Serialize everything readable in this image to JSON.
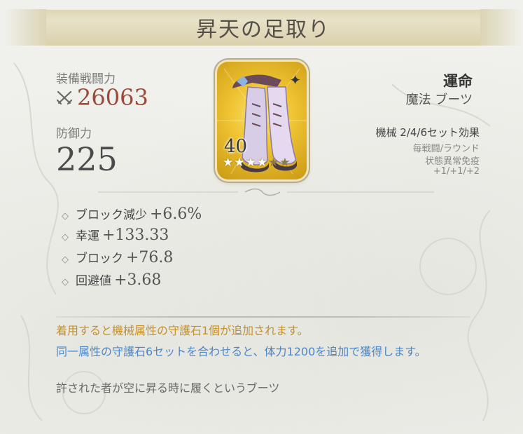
{
  "title": "昇天の足取り",
  "power": {
    "label": "装備戦闘力",
    "value": "26063"
  },
  "defense": {
    "label": "防御力",
    "value": "225"
  },
  "item": {
    "level": "40",
    "stars_total": 6,
    "stars_filled": 4,
    "accent_color": "#f0c433"
  },
  "name": {
    "main": "運命",
    "type": "魔法 ブーツ"
  },
  "set_effect": {
    "title": "機械 2/4/6セット効果",
    "lines": [
      "毎戦闘/ラウンド",
      "状態異常免疫",
      "+1/+1/+2"
    ]
  },
  "substats": [
    {
      "label": "ブロック減少",
      "value": "+6.6%"
    },
    {
      "label": "幸運",
      "value": "+133.33"
    },
    {
      "label": "ブロック",
      "value": "+76.8"
    },
    {
      "label": "回避値",
      "value": "+3.68"
    }
  ],
  "descriptions": {
    "gold": "着用すると機械属性の守護石1個が追加されます。",
    "blue": "同一属性の守護石6セットを合わせると、体力1200を追加で獲得します。",
    "gray": "許された者が空に昇る時に履くというブーツ"
  },
  "colors": {
    "power": "#9a4a3a",
    "gold_text": "#c4902a",
    "blue_text": "#4c86c6"
  }
}
